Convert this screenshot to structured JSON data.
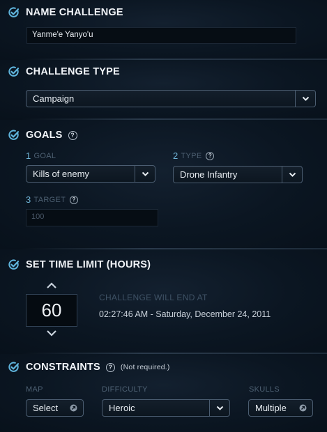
{
  "name_section": {
    "heading": "NAME CHALLENGE",
    "value": "Yanme'e Yanyo'u"
  },
  "type_section": {
    "heading": "CHALLENGE TYPE",
    "selected": "Campaign"
  },
  "goals_section": {
    "heading": "GOALS",
    "help": "?",
    "goal_num": "1",
    "goal_label": "GOAL",
    "goal_value": "Kills of enemy",
    "type_num": "2",
    "type_label": "TYPE",
    "type_value": "Drone Infantry",
    "target_num": "3",
    "target_label": "TARGET",
    "target_placeholder": "100"
  },
  "time_section": {
    "heading": "SET TIME LIMIT (HOURS)",
    "hours": "60",
    "end_label": "CHALLENGE WILL END AT",
    "end_time": "02:27:46 AM - Saturday, December 24, 2011"
  },
  "constraints_section": {
    "heading": "CONSTRAINTS",
    "help": "?",
    "note": "(Not required.)",
    "map_label": "MAP",
    "map_value": "Select",
    "difficulty_label": "DIFFICULTY",
    "difficulty_value": "Heroic",
    "skulls_label": "SKULLS",
    "skulls_value": "Multiple"
  },
  "colors": {
    "accent": "#5fb4dc",
    "background": "#08111b"
  },
  "icons": {
    "check": "check-circle-icon",
    "dropdown": "chevron-down-icon",
    "external": "external-link-icon",
    "increment": "chevron-up-icon",
    "decrement": "chevron-down-icon"
  }
}
